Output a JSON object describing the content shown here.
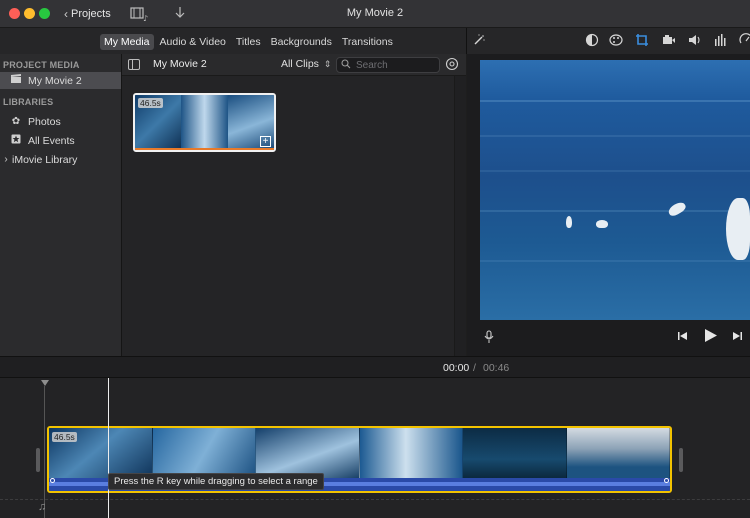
{
  "window": {
    "title": "My Movie 2",
    "projects_label": "Projects",
    "icons": [
      "media-browser-toggle-icon",
      "import-icon"
    ]
  },
  "media_tabs": [
    {
      "label": "My Media",
      "active": true
    },
    {
      "label": "Audio & Video",
      "active": false
    },
    {
      "label": "Titles",
      "active": false
    },
    {
      "label": "Backgrounds",
      "active": false
    },
    {
      "label": "Transitions",
      "active": false
    }
  ],
  "viewer_tools": [
    "magic-wand-icon",
    "color-balance-icon",
    "color-correction-icon",
    "crop-icon",
    "stabilization-icon",
    "volume-icon",
    "equalizer-icon",
    "speed-icon"
  ],
  "sidebar": {
    "project_media_heading": "PROJECT MEDIA",
    "project_item": "My Movie 2",
    "libraries_heading": "LIBRARIES",
    "library_items": [
      {
        "label": "Photos",
        "icon": "photos-icon"
      },
      {
        "label": "All Events",
        "icon": "star-icon"
      },
      {
        "label": "iMovie Library",
        "icon": "chevron-right-icon"
      }
    ]
  },
  "browser": {
    "title": "My Movie 2",
    "filter_label": "All Clips",
    "search_placeholder": "Search",
    "clip": {
      "duration": "46.5s"
    }
  },
  "playback": {
    "current_time": "00:00",
    "separator": "/",
    "total_time": "00:46"
  },
  "timeline": {
    "clip_duration": "46.5s",
    "tooltip": "Press the R key while dragging to select a range",
    "music_icon": "music-note-icon"
  },
  "colors": {
    "selection_yellow": "#f3c300",
    "audio_blue": "#2a4aa8",
    "accent_orange": "#e87a2a"
  }
}
